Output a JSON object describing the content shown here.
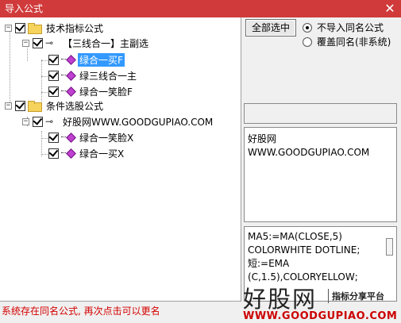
{
  "window": {
    "title": "导入公式",
    "close_label": "✕"
  },
  "tree": {
    "groups": [
      {
        "label": "技术指标公式",
        "formula": "【三线合一】主副选",
        "items": [
          "绿合一买F",
          "绿三线合一主",
          "绿合一笑脸F"
        ],
        "selected_item": "绿合一买F"
      },
      {
        "label": "条件选股公式",
        "formula": "好股网WWW.GOODGUPIAO.COM",
        "items": [
          "绿合一笑脸X",
          "绿合一买X"
        ]
      }
    ]
  },
  "buttons": {
    "select_all": "全部选中"
  },
  "options": {
    "no_import_same": "不导入同名公式",
    "overwrite_same": "覆盖同名(非系统)",
    "selected": "no_import_same"
  },
  "description": {
    "line1": "好股网",
    "line2": "WWW.GOODGUPIAO.COM"
  },
  "code": {
    "lines": [
      "MA5:=MA(CLOSE,5)",
      "COLORWHITE DOTLINE;",
      "短:=EMA",
      "(C,1.5),COLORYELLOW;"
    ]
  },
  "status": {
    "message": "系统存在同名公式, 再次点击可以更名"
  },
  "watermark": {
    "brand": "好股网",
    "slogan": "指标分享平台",
    "url": "WWW.GOODGUPIAO.COM"
  },
  "colors": {
    "titlebar": "#d03a3a",
    "selection": "#3399ff",
    "status": "#d40000",
    "watermark_url": "#cc0000"
  }
}
